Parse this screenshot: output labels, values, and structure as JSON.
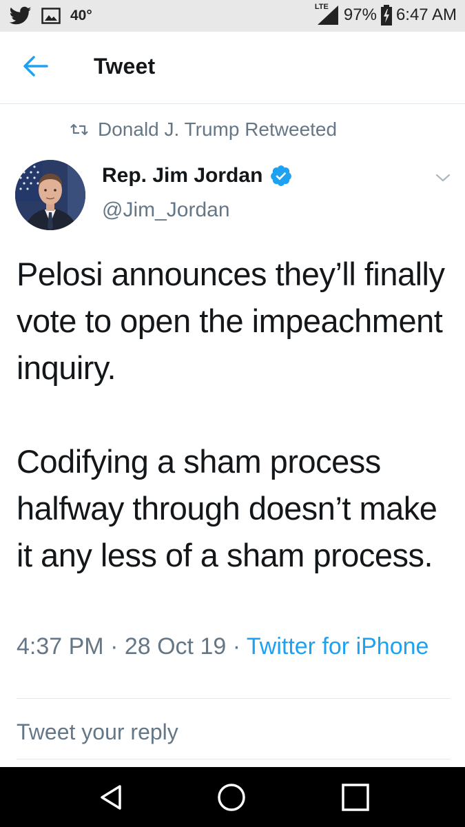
{
  "status_bar": {
    "temperature": "40°",
    "network": "LTE",
    "battery": "97%",
    "time": "6:47 AM"
  },
  "header": {
    "title": "Tweet"
  },
  "tweet": {
    "retweet_context": "Donald J. Trump Retweeted",
    "author_name": "Rep. Jim Jordan",
    "author_handle": "@Jim_Jordan",
    "text_paragraphs": [
      "Pelosi announces they’ll finally vote to open the impeachment inquiry.",
      "Codifying a sham process halfway through doesn’t make it any less of a sham process."
    ],
    "timestamp": "4:37 PM",
    "date": "28 Oct 19",
    "separator": " · ",
    "source": "Twitter for iPhone"
  },
  "reply": {
    "placeholder": "Tweet your reply"
  },
  "colors": {
    "accent": "#1da1f2",
    "secondary_text": "#657786",
    "primary_text": "#14171a"
  }
}
